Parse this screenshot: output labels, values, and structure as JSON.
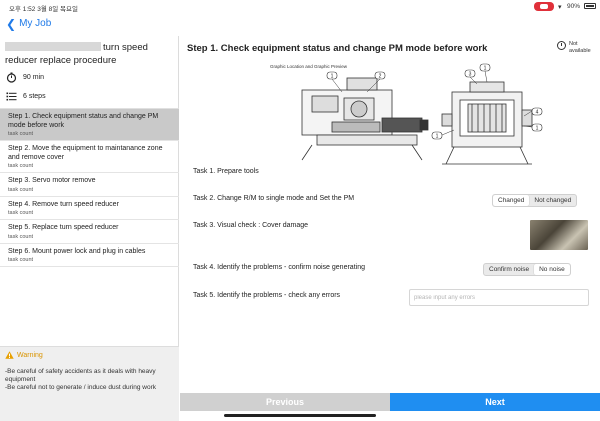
{
  "status_bar": {
    "time": "오후 1:52  3월 8일 목요일",
    "battery": "90%"
  },
  "nav": {
    "back_label": "My Job"
  },
  "sidebar": {
    "title": "turn speed reducer replace procedure",
    "duration": "90 min",
    "steps_count": "6 steps",
    "steps": [
      {
        "title": "Step 1. Check equipment status and change PM mode before work",
        "count": "task count"
      },
      {
        "title": "Step 2. Move the equipment to maintanance zone and remove cover",
        "count": "task count"
      },
      {
        "title": "Step 3. Servo motor remove",
        "count": "task count"
      },
      {
        "title": "Step 4. Remove turn speed reducer",
        "count": "task count"
      },
      {
        "title": "Step 5. Replace turn speed reducer",
        "count": "task count"
      },
      {
        "title": "Step 6. Mount power lock and plug in cables",
        "count": "task count"
      }
    ],
    "warning": {
      "title": "Warning",
      "lines": [
        "-Be careful of safety accidents as it deals with heavy equipment",
        "-Be careful not to generate / induce dust during work"
      ]
    }
  },
  "main": {
    "step_title": "Step 1. Check equipment status and change PM mode before work",
    "not_available": "Not available",
    "graphic_caption": "Graphic Location and Graphic Preview",
    "callouts": [
      "1",
      "2",
      "3",
      "1",
      "4",
      "1",
      "1"
    ],
    "tasks": {
      "t1": "Task 1. Prepare tools",
      "t2": "Task 2. Change R/M to single mode and Set the PM",
      "t3": "Task 3. Visual check : Cover damage",
      "t4": "Task 4. Identify the problems - confirm noise generating",
      "t5": "Task 5. Identify the problems - check any errors"
    },
    "task2_options": [
      "Changed",
      "Not changed"
    ],
    "task4_options": [
      "Confirm noise",
      "No noise"
    ],
    "task5_placeholder": "please input any errors",
    "prev_label": "Previous",
    "next_label": "Next"
  },
  "colors": {
    "accent": "#1f8ef1",
    "back_link": "#1f7ae8",
    "warning": "#d99400",
    "selected_step": "#c9c9c9"
  }
}
